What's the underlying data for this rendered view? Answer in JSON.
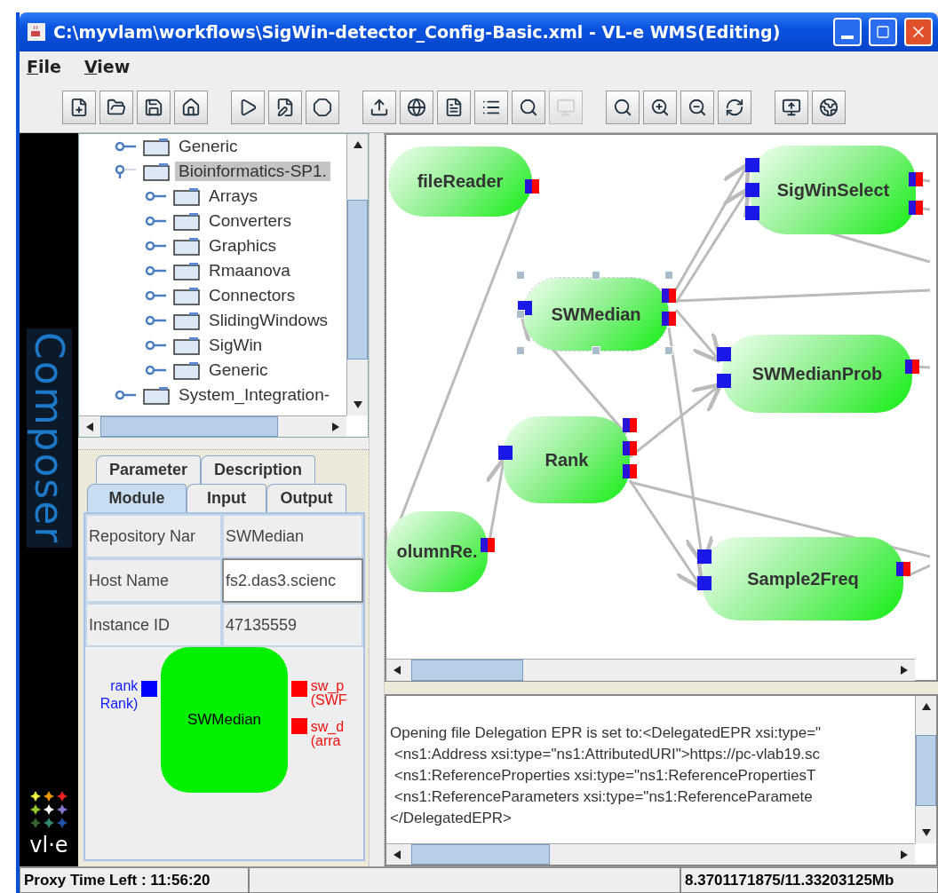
{
  "window": {
    "title": "C:\\myvlam\\workflows\\SigWin-detector_Config-Basic.xml - VL-e WMS(Editing)"
  },
  "menu": [
    {
      "label": "File"
    },
    {
      "label": "View"
    }
  ],
  "toolbar": [
    [
      {
        "disabled": false
      },
      {
        "disabled": false
      },
      {
        "disabled": false
      },
      {
        "disabled": false
      }
    ],
    [
      {
        "disabled": false
      },
      {
        "disabled": false
      },
      {
        "disabled": false
      }
    ],
    [
      {
        "disabled": false
      },
      {
        "disabled": false
      },
      {
        "disabled": false
      },
      {
        "disabled": false
      },
      {
        "disabled": false
      },
      {
        "disabled": true
      }
    ],
    [
      {
        "disabled": false
      },
      {
        "disabled": false
      },
      {
        "disabled": false
      },
      {
        "disabled": false
      }
    ],
    [
      {
        "disabled": false
      },
      {
        "disabled": false
      }
    ]
  ],
  "sidebar": {
    "title": "Composer",
    "logo": "vl·e"
  },
  "tree": [
    {
      "label": "Generic",
      "selected": false,
      "expanded": false
    },
    {
      "label": "Bioinformatics-SP1.",
      "selected": true,
      "expanded": true,
      "children": [
        {
          "label": "Arrays",
          "selected": false,
          "expanded": false
        },
        {
          "label": "Converters",
          "selected": false,
          "expanded": false
        },
        {
          "label": "Graphics",
          "selected": false,
          "expanded": false
        },
        {
          "label": "Rmaanova",
          "selected": false,
          "expanded": false
        },
        {
          "label": "Connectors",
          "selected": false,
          "expanded": false
        },
        {
          "label": "SlidingWindows",
          "selected": false,
          "expanded": false
        },
        {
          "label": "SigWin",
          "selected": false,
          "expanded": false
        },
        {
          "label": "Generic",
          "selected": false,
          "expanded": false
        }
      ]
    },
    {
      "label": "System_Integration-",
      "selected": false,
      "expanded": false
    }
  ],
  "tab_rows": [
    {
      "tabs": [
        {
          "label": "Parameter",
          "selected": false
        },
        {
          "label": "Description",
          "selected": false
        }
      ]
    },
    {
      "tabs": [
        {
          "label": "Module",
          "selected": true
        },
        {
          "label": "Input",
          "selected": false
        },
        {
          "label": "Output",
          "selected": false
        }
      ]
    }
  ],
  "properties": [
    {
      "label": "Repository Nar",
      "value": "SWMedian",
      "kind": "text"
    },
    {
      "label": "Host Name",
      "value": "fs2.das3.scienc",
      "kind": "field"
    },
    {
      "label": "Instance ID",
      "value": "47135559",
      "kind": "text"
    }
  ],
  "preview": {
    "label": "SWMedian",
    "inputs": [
      {
        "name": "rank",
        "type": "Rank)"
      }
    ],
    "outputs": [
      {
        "name": "sw_p",
        "type": "(SWF"
      },
      {
        "name": "sw_d",
        "type": "(arra"
      }
    ]
  },
  "canvas": {
    "nodes": [
      {
        "label": "fileReader",
        "selected": false
      },
      {
        "label": "SigWinSelect",
        "selected": false
      },
      {
        "label": "SWMedian",
        "selected": true
      },
      {
        "label": "SWMedianProb",
        "selected": false
      },
      {
        "label": "Rank",
        "selected": false
      },
      {
        "label": "olumnRe.",
        "selected": false
      },
      {
        "label": "Sample2Freq",
        "selected": false
      }
    ]
  },
  "log": [
    "Opening file Delegation EPR is set to:<DelegatedEPR xsi:type=\"",
    " <ns1:Address xsi:type=\"ns1:AttributedURI\">https://pc-vlab19.sc",
    " <ns1:ReferenceProperties xsi:type=\"ns1:ReferencePropertiesT",
    " <ns1:ReferenceParameters xsi:type=\"ns1:ReferenceParamete",
    "</DelegatedEPR>"
  ],
  "status_bar": {
    "left": "Proxy Time Left : 11:56:20",
    "right": "8.3701171875/11.33203125Mb"
  }
}
